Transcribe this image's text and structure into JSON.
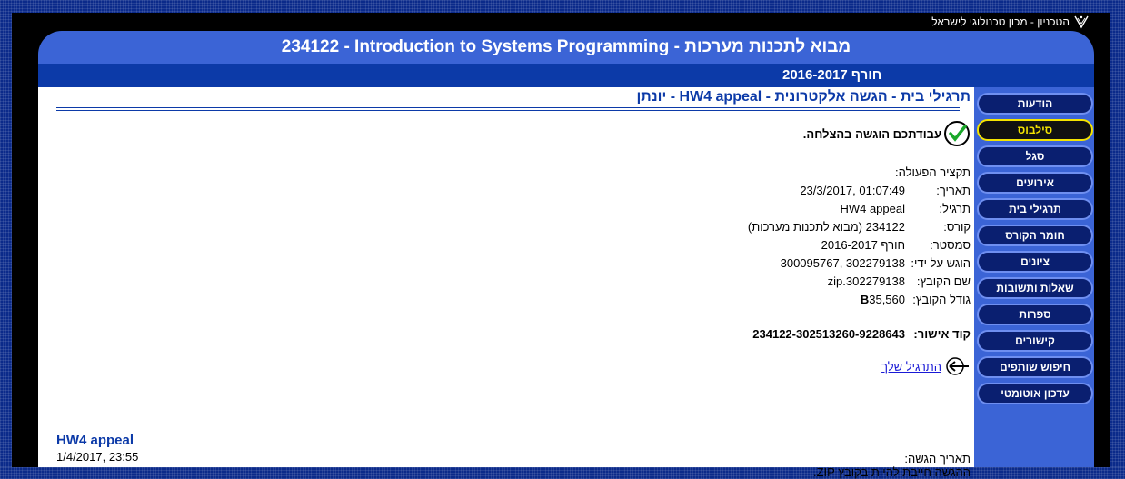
{
  "topbar": {
    "text": "הטכניון - מכון טכנולוגי לישראל",
    "icon": "technion-logo-icon"
  },
  "header": {
    "title": "234122 - Introduction to Systems Programming - מבוא לתכנות מערכות",
    "semester": "חורף 2016-2017"
  },
  "nav": [
    {
      "label": "הודעות",
      "active": false
    },
    {
      "label": "סילבוס",
      "active": true
    },
    {
      "label": "סגל",
      "active": false
    },
    {
      "label": "אירועים",
      "active": false
    },
    {
      "label": "תרגילי בית",
      "active": false
    },
    {
      "label": "חומר הקורס",
      "active": false
    },
    {
      "label": "ציונים",
      "active": false
    },
    {
      "label": "שאלות ותשובות",
      "active": false
    },
    {
      "label": "ספרות",
      "active": false
    },
    {
      "label": "קישורים",
      "active": false
    },
    {
      "label": "חיפוש שותפים",
      "active": false
    },
    {
      "label": "עדכון אוטומטי",
      "active": false
    }
  ],
  "page": {
    "title": "תרגילי בית - הגשה אלקטרונית - HW4 appeal - יונתן",
    "success_msg": "עבודתכם הוגשה בהצלחה.",
    "summary_heading": "תקציר הפעולה:",
    "details": [
      {
        "label": "תאריך:",
        "value": "01:07:49 ,23/3/2017"
      },
      {
        "label": "תרגיל:",
        "value": "HW4 appeal"
      },
      {
        "label": "קורס:",
        "value": "234122 (מבוא לתכנות מערכות)"
      },
      {
        "label": "סמסטר:",
        "value": "חורף 2016-2017"
      },
      {
        "label": "הוגש על ידי:",
        "value": "302279138 ,300095767"
      },
      {
        "label": "שם הקובץ:",
        "value": "302279138.zip"
      },
      {
        "label": "גודל הקובץ:",
        "value": "35,560",
        "unit": "B"
      }
    ],
    "approval_label": "קוד אישור:",
    "approval_code": "234122-302513260-9228643",
    "back_link": "התרגיל שלך",
    "hw_title": "HW4 appeal",
    "hw_date": "1/4/2017, 23:55",
    "submission_date_label": "תאריך הגשה:",
    "submission_note": "ההגשה חייבת להיות בקובץ ZIP."
  },
  "colors": {
    "header_blue": "#3b64d6",
    "dark_blue": "#0c3aa8",
    "active_yellow": "#f5e400"
  }
}
